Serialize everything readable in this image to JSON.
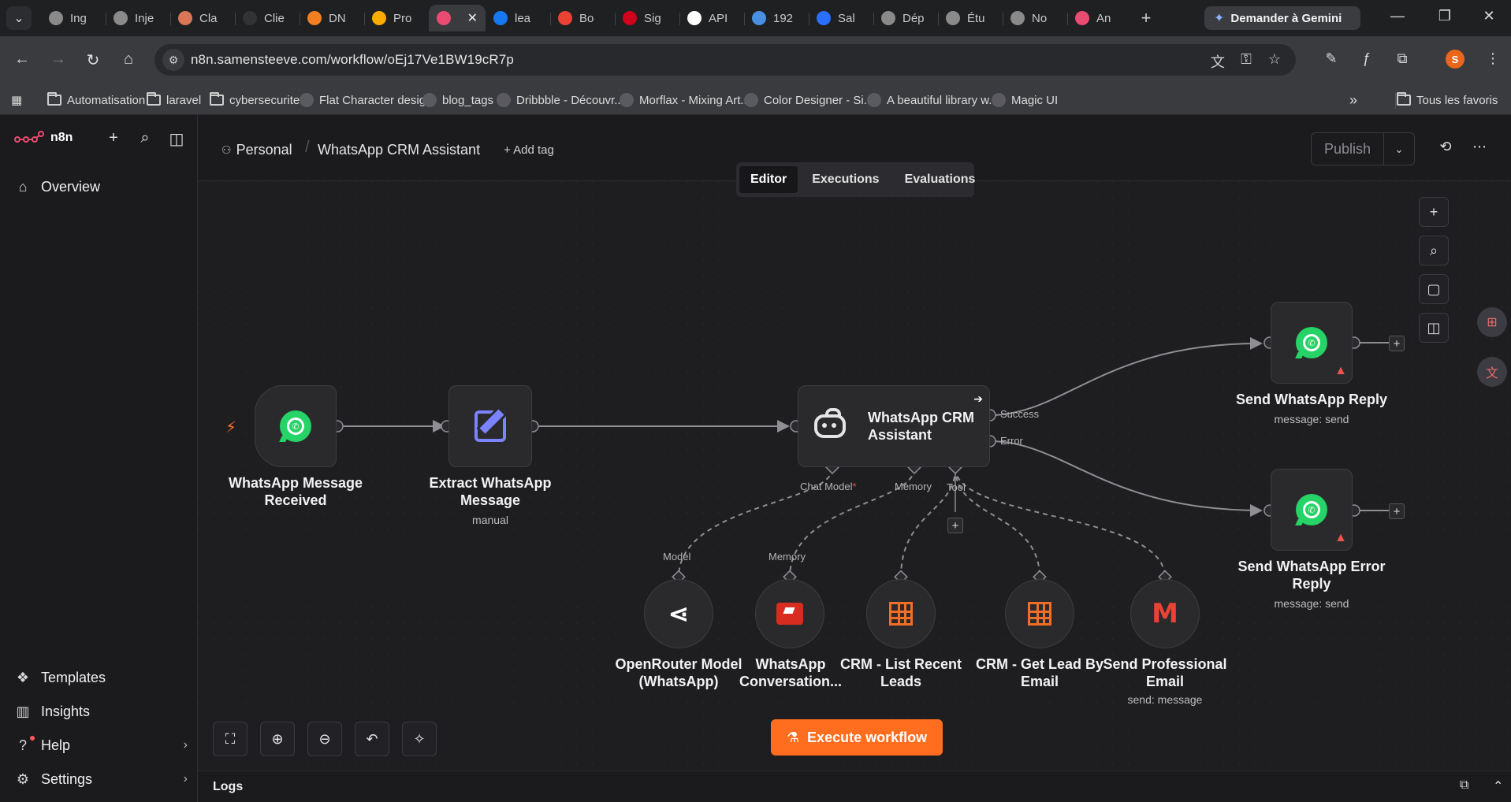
{
  "browser": {
    "tabs": [
      {
        "label": "Ing",
        "icon": "person-avatar-icon",
        "color": "#8a8a8a"
      },
      {
        "label": "Inje",
        "icon": "n8n-icon",
        "color": "#8a8a8a"
      },
      {
        "label": "Cla",
        "icon": "claude-icon",
        "color": "#d97757"
      },
      {
        "label": "Clie",
        "icon": "shield-icon",
        "color": "#333333"
      },
      {
        "label": "DN",
        "icon": "cloudflare-icon",
        "color": "#f38020"
      },
      {
        "label": "Pro",
        "icon": "analytics-icon",
        "color": "#f9ab00"
      },
      {
        "label": "",
        "icon": "n8n-icon",
        "color": "#ea4b71",
        "active": true
      },
      {
        "label": "lea",
        "icon": "facebook-icon",
        "color": "#1877f2"
      },
      {
        "label": "Bo",
        "icon": "gmail-icon",
        "color": "#ea4335"
      },
      {
        "label": "Sig",
        "icon": "w-logo-icon",
        "color": "#d0021b"
      },
      {
        "label": "API",
        "icon": "api-icon",
        "color": "#ffffff"
      },
      {
        "label": "192",
        "icon": "c-logo-icon",
        "color": "#4a90e2"
      },
      {
        "label": "Sal",
        "icon": "v-logo-icon",
        "color": "#2b6fff"
      },
      {
        "label": "Dép",
        "icon": "person-avatar-icon",
        "color": "#8a8a8a"
      },
      {
        "label": "Étu",
        "icon": "person-avatar-icon",
        "color": "#8a8a8a"
      },
      {
        "label": "No",
        "icon": "chrome-icon",
        "color": "#8a8a8a"
      },
      {
        "label": "An",
        "icon": "n8n-icon",
        "color": "#ea4b71"
      }
    ],
    "gemini_label": "Demander à Gemini",
    "url": "n8n.samensteeve.com/workflow/oEj17Ve1BW19cR7p",
    "profile_initial": "S",
    "bookmarks": [
      {
        "label": "Automatisation",
        "icon": "folder-icon"
      },
      {
        "label": "laravel",
        "icon": "folder-icon"
      },
      {
        "label": "cybersecurite",
        "icon": "folder-icon"
      },
      {
        "label": "Flat Character desig...",
        "icon": "globe-icon"
      },
      {
        "label": "blog_tags",
        "icon": "chart-logo-icon"
      },
      {
        "label": "Dribbble - Découvr...",
        "icon": "globe-icon"
      },
      {
        "label": "Morflax - Mixing Art...",
        "icon": "morflax-icon"
      },
      {
        "label": "Color Designer - Si...",
        "icon": "color-designer-icon"
      },
      {
        "label": "A beautiful library w...",
        "icon": "library-icon"
      },
      {
        "label": "Magic UI",
        "icon": "magic-ui-icon"
      }
    ],
    "all_bookmarks_label": "Tous les favoris"
  },
  "sidebar": {
    "brand": "n8n",
    "overview": "Overview",
    "templates": "Templates",
    "insights": "Insights",
    "help": "Help",
    "settings": "Settings"
  },
  "header": {
    "project": "Personal",
    "workflow_name": "WhatsApp CRM Assistant",
    "add_tag": "+ Add tag",
    "publish": "Publish",
    "modes": [
      "Editor",
      "Executions",
      "Evaluations"
    ],
    "active_mode": "Editor"
  },
  "canvas": {
    "nodes": {
      "trigger": {
        "label": "WhatsApp Message Received",
        "icon": "whatsapp-icon"
      },
      "extract": {
        "label": "Extract WhatsApp Message",
        "sub": "manual",
        "icon": "edit-icon"
      },
      "agent": {
        "label": "WhatsApp CRM Assistant",
        "icon": "robot-icon",
        "out_success": "Success",
        "out_error": "Error",
        "in_chat_model": "Chat Model",
        "in_memory": "Memory",
        "in_tool": "Tool"
      },
      "reply": {
        "label": "Send WhatsApp Reply",
        "sub": "message: send",
        "icon": "whatsapp-icon"
      },
      "error_reply": {
        "label": "Send WhatsApp Error Reply",
        "sub": "message: send",
        "icon": "whatsapp-icon"
      },
      "openrouter": {
        "label": "OpenRouter Model (WhatsApp)",
        "port": "Model",
        "icon": "openrouter-icon"
      },
      "memory": {
        "label": "WhatsApp Conversation...",
        "port": "Memory",
        "icon": "redis-icon"
      },
      "list_leads": {
        "label": "CRM - List Recent Leads",
        "icon": "table-icon"
      },
      "get_lead": {
        "label": "CRM - Get Lead By Email",
        "icon": "table-icon"
      },
      "email": {
        "label": "Send Professional Email",
        "sub": "send: message",
        "icon": "gmail-icon"
      }
    },
    "execute_label": "Execute workflow",
    "logs_label": "Logs",
    "colors": {
      "accent": "#ff6d1f",
      "whatsapp": "#25d366",
      "warning": "#f0534a"
    }
  }
}
